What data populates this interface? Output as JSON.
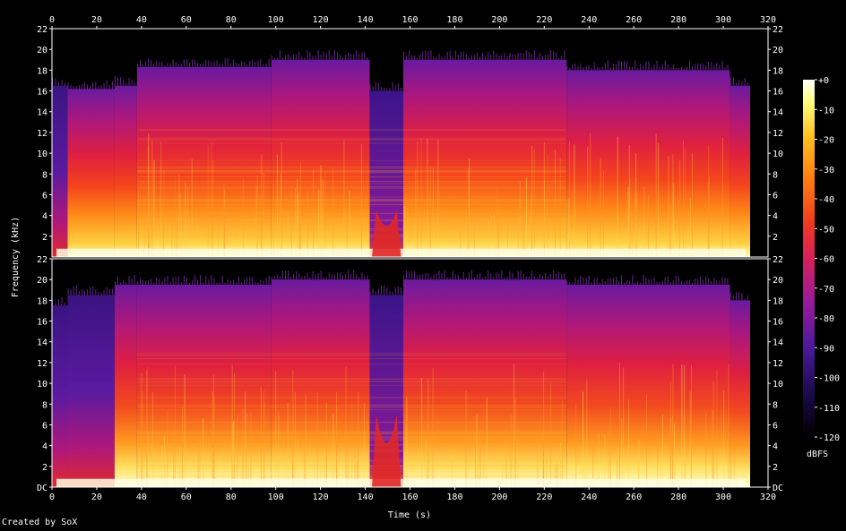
{
  "chart_data": {
    "type": "heatmap",
    "title": "",
    "xlabel": "Time (s)",
    "ylabel": "Frequency (kHz)",
    "xlim": [
      0,
      320
    ],
    "ylim": [
      0,
      22
    ],
    "x_ticks": [
      "0",
      "20",
      "40",
      "60",
      "80",
      "100",
      "120",
      "140",
      "160",
      "180",
      "200",
      "220",
      "240",
      "260",
      "280",
      "300",
      "320"
    ],
    "y_ticks_top": [
      "2",
      "4",
      "6",
      "8",
      "10",
      "12",
      "14",
      "16",
      "18",
      "20",
      "22"
    ],
    "y_ticks_bottom": [
      "DC",
      "2",
      "4",
      "6",
      "8",
      "10",
      "12",
      "14",
      "16",
      "18",
      "20",
      "22"
    ],
    "colorbar": {
      "unit": "dBFS",
      "range": [
        -120,
        0
      ],
      "ticks": [
        "+0",
        "-10",
        "-20",
        "-30",
        "-40",
        "-50",
        "-60",
        "-70",
        "-80",
        "-90",
        "-100",
        "-110",
        "-120"
      ]
    },
    "channels": [
      {
        "panel": "top",
        "segments": [
          {
            "start": 0,
            "end": 7,
            "cutoff_khz": 16.5
          },
          {
            "start": 7,
            "end": 28,
            "cutoff_khz": 16.2
          },
          {
            "start": 28,
            "end": 38,
            "cutoff_khz": 16.5
          },
          {
            "start": 38,
            "end": 98,
            "cutoff_khz": 18.3
          },
          {
            "start": 98,
            "end": 142,
            "cutoff_khz": 19.0
          },
          {
            "start": 142,
            "end": 157,
            "cutoff_khz": 16.0
          },
          {
            "start": 157,
            "end": 230,
            "cutoff_khz": 19.0
          },
          {
            "start": 230,
            "end": 303,
            "cutoff_khz": 18.0
          },
          {
            "start": 303,
            "end": 312,
            "cutoff_khz": 16.5
          }
        ],
        "quiet_gap": {
          "start": 143,
          "end": 156
        }
      },
      {
        "panel": "bottom",
        "segments": [
          {
            "start": 0,
            "end": 7,
            "cutoff_khz": 17.5
          },
          {
            "start": 7,
            "end": 28,
            "cutoff_khz": 18.5
          },
          {
            "start": 28,
            "end": 38,
            "cutoff_khz": 19.5
          },
          {
            "start": 38,
            "end": 98,
            "cutoff_khz": 19.5
          },
          {
            "start": 98,
            "end": 142,
            "cutoff_khz": 20.0
          },
          {
            "start": 142,
            "end": 157,
            "cutoff_khz": 18.5
          },
          {
            "start": 157,
            "end": 230,
            "cutoff_khz": 20.0
          },
          {
            "start": 230,
            "end": 303,
            "cutoff_khz": 19.5
          },
          {
            "start": 303,
            "end": 312,
            "cutoff_khz": 18.0
          }
        ],
        "quiet_gap": {
          "start": 143,
          "end": 156
        }
      }
    ]
  },
  "footer": "Created by SoX",
  "colors": {
    "background": "#000000",
    "palette": [
      "#000000",
      "#1a0a4a",
      "#4b1a9a",
      "#9a1a9a",
      "#d81f5a",
      "#f03a20",
      "#ff7d10",
      "#ffc020",
      "#ffff80",
      "#ffffff"
    ]
  }
}
